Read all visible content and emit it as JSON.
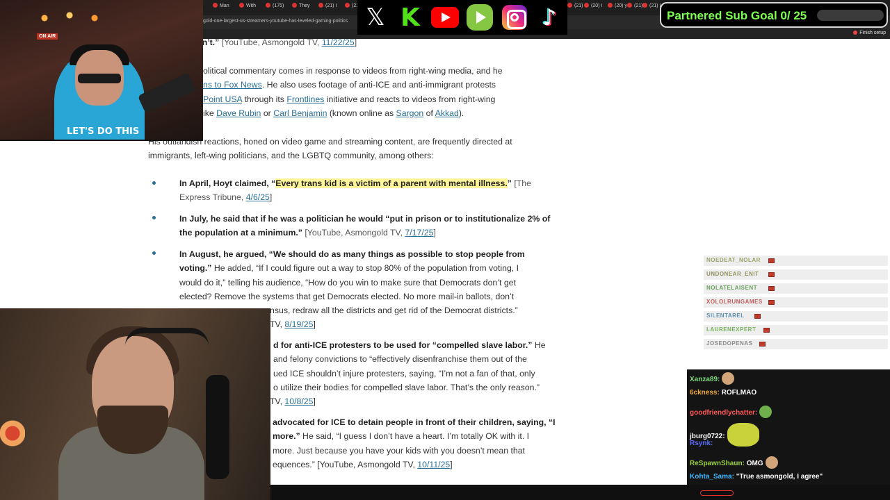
{
  "browser": {
    "tabs": [
      "Man",
      "With",
      "(175)",
      "They",
      "(21) I",
      "(21) I",
      "(21) I",
      "(20) I",
      "(20) y",
      "(21) I",
      "(21) I",
      "(21) I"
    ],
    "url": "gold-one-largest-us-streamers-youtube-has-leveled-gaming-politics",
    "finish_setup": "Finish setup"
  },
  "overlay": {
    "social_icons": [
      "x-icon",
      "kick-icon",
      "youtube-icon",
      "rumble-icon",
      "instagram-icon",
      "tiktok-icon"
    ],
    "sub_goal": "Partnered Sub Goal 0/ 25",
    "cam1_onair": "ON AIR",
    "cam1_shirt": "LET'S DO THIS"
  },
  "article": {
    "p0": {
      "text": "e didn’t.”",
      "cite_open": " [YouTube, Asmongold TV, ",
      "cite_link": "11/22/25",
      "cite_close": "]"
    },
    "p1": {
      "l1": "olitical commentary comes in response to videos from right-wing media, and he",
      "l2_link": "ns to Fox News",
      "l2_rest": ". He also uses footage of anti-ICE and anti-immigrant protests",
      "l3_link": "Point USA",
      "l3_mid": " through its ",
      "l3_link2": "Frontlines",
      "l3_rest": " initiative and reacts to videos from right-wing",
      "l4_pre": "ike ",
      "l4_link1": "Dave Rubin",
      "l4_or": " or ",
      "l4_link2": "Carl Benjamin",
      "l4_mid": " (known online as ",
      "l4_link3": "Sargon",
      "l4_of": " of ",
      "l4_link4": "Akkad",
      "l4_end": ")."
    },
    "p2": {
      "l1": "His outlandish reactions, honed on video game and streaming content, are frequently directed at",
      "l2": "immigrants, left-wing politicians, and the LGBTQ community, among others:"
    },
    "bullet1": {
      "lead": "In April, Hoyt claimed, “",
      "quote": "Every trans kid is a victim of a parent with mental illness.",
      "close": "”",
      "cite_open": " [The",
      "l2": "Express Tribune, ",
      "cite_link": "4/6/25",
      "cite_close": "]"
    },
    "bullet2": {
      "l1": "In July, he said that if he was a politician he would “put in prison or to institutionalize 2% of",
      "l2": "the population at a minimum.”",
      "cite_open": " [YouTube, Asmongold TV, ",
      "cite_link": "7/17/25",
      "cite_close": "]"
    },
    "bullet3": {
      "l1": "In August, he argued, “We should do as many things as possible to stop people from",
      "l2_bold": "voting.”",
      "l2_rest": " He added, “If I could figure out a way to stop 80% of the population from voting, I",
      "l3": "would do it,” telling his audience, “How do you win to make sure that Democrats don’t get",
      "l4": "elected? Remove the systems that get Democrats elected. No more mail-in ballots, don’t",
      "l5": "nsus, redraw all the districts and get rid of the Democrat districts.”",
      "l6_pre": "TV, ",
      "cite_link": "8/19/25",
      "cite_close": "]"
    },
    "bullet4": {
      "l1_bold": "d for anti-ICE protesters to be used for “compelled slave labor.”",
      "l1_rest": " He",
      "l2": "and felony convictions to “effectively disenfranchise them out of the",
      "l3": "ued ICE shouldn’t injure protesters, saying, “I’m not a fan of that, only",
      "l4": "o utilize their bodies for compelled slave labor. That’s the only reason.”",
      "l5_pre": "TV, ",
      "cite_link": "10/8/25",
      "cite_close": "]"
    },
    "bullet5": {
      "l1_bold": "advocated for ICE to detain people in front of their children, saying, “I",
      "l2_bold": "more.”",
      "l2_rest": " He said, “I guess I don’t have a heart. I’m totally OK with it. I",
      "l3": "more. Just because you have your kids with you doesn’t mean that",
      "l4": "equences.” [YouTube, Asmongold TV, ",
      "cite_link": "10/11/25",
      "cite_close": "]"
    }
  },
  "chat": {
    "messages": [
      {
        "user": "Xanza89:",
        "color": "#7dd87d",
        "text": ""
      },
      {
        "user": "6ckness:",
        "color": "#f2a93b",
        "text": "ROFLMAO"
      },
      {
        "user": "goodfriendlychatter:",
        "color": "#ff5a5a",
        "text": ""
      },
      {
        "user": "jburg0722:",
        "color": "#ffffff",
        "text": ""
      },
      {
        "user": "Rsynk:",
        "color": "#5a6bff",
        "text": ""
      },
      {
        "user": "ReSpawnShaun:",
        "color": "#9bd13b",
        "text": "OMG"
      },
      {
        "user": "Kohta_Sama:",
        "color": "#3fb8ff",
        "text": "\"True asmongold, I agree\""
      }
    ],
    "faded_names": [
      "NOEDEAT_NOLAR",
      "UNDONEAR_ENIT",
      "NOLATELAISENT",
      "XOLOLRUNGAMES",
      "SILENTAREL",
      "LAURENEXPERT",
      "JOSEDOPENAS"
    ],
    "faded_colors": [
      "#9aa06a",
      "#8f8f5c",
      "#6aa05c",
      "#c05b5b",
      "#5c8fb0",
      "#7ab05c",
      "#8f8f8f"
    ]
  }
}
